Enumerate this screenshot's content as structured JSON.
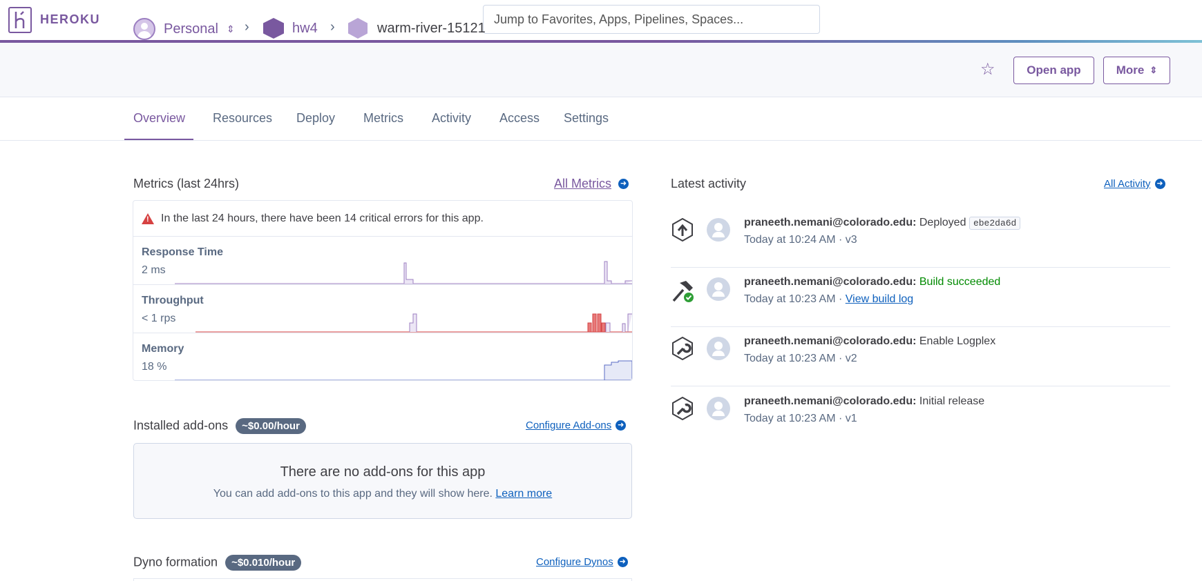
{
  "brand": {
    "name": "HEROKU",
    "logo_letter": "K"
  },
  "search": {
    "placeholder": "Jump to Favorites, Apps, Pipelines, Spaces..."
  },
  "breadcrumb": {
    "account": "Personal",
    "pipeline": "hw4",
    "app": "warm-river-15121"
  },
  "header_actions": {
    "open_app": "Open app",
    "more": "More"
  },
  "tabs": [
    "Overview",
    "Resources",
    "Deploy",
    "Metrics",
    "Activity",
    "Access",
    "Settings"
  ],
  "metrics": {
    "title": "Metrics (last 24hrs)",
    "all_link": "All Metrics",
    "alert": "In the last 24 hours, there have been 14 critical errors for this app.",
    "rows": [
      {
        "label": "Response Time",
        "value": "2 ms"
      },
      {
        "label": "Throughput",
        "value": "< 1 rps"
      },
      {
        "label": "Memory",
        "value": "18 %"
      }
    ]
  },
  "addons": {
    "title": "Installed add-ons",
    "price": "~$0.00/hour",
    "configure_link": "Configure Add-ons",
    "empty_title": "There are no add-ons for this app",
    "empty_text": "You can add add-ons to this app and they will show here.",
    "learn_more": "Learn more"
  },
  "dynos": {
    "title": "Dyno formation",
    "price": "~$0.010/hour",
    "configure_link": "Configure Dynos"
  },
  "activity": {
    "title": "Latest activity",
    "all_link": "All Activity",
    "items": [
      {
        "user": "praneeth.nemani@colorado.edu:",
        "action": "Deployed",
        "sha": "ebe2da6d",
        "time": "Today at 10:24 AM · v3",
        "icon": "deploy-arrow-icon"
      },
      {
        "user": "praneeth.nemani@colorado.edu:",
        "action": "Build succeeded",
        "time": "Today at 10:23 AM · ",
        "link": "View build log",
        "icon": "build-hammer-icon"
      },
      {
        "user": "praneeth.nemani@colorado.edu:",
        "action": "Enable Logplex",
        "time": "Today at 10:23 AM · v2",
        "icon": "wrench-icon"
      },
      {
        "user": "praneeth.nemani@colorado.edu:",
        "action": "Initial release",
        "time": "Today at 10:23 AM · v1",
        "icon": "wrench-icon"
      }
    ]
  },
  "colors": {
    "brand": "#79589f",
    "link": "#0e60bd",
    "error": "#d64242",
    "success": "#008a00"
  }
}
